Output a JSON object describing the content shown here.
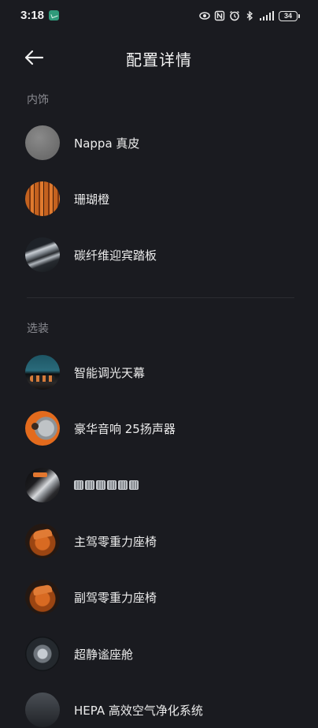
{
  "status_bar": {
    "time": "3:18",
    "battery": "34",
    "icons": [
      "eye-icon",
      "nfc-icon",
      "alarm-icon",
      "bluetooth-icon",
      "signal-icon",
      "battery-icon"
    ]
  },
  "header": {
    "title": "配置详情",
    "back_icon": "arrow-left-icon"
  },
  "sections": {
    "interior": {
      "label": "内饰",
      "items": [
        {
          "label": "Nappa 真皮",
          "thumb": "nappa-leather-swatch"
        },
        {
          "label": "珊瑚橙",
          "thumb": "coral-orange-swatch"
        },
        {
          "label": "碳纤维迎宾踏板",
          "thumb": "carbon-fiber-sill-plate"
        }
      ]
    },
    "options": {
      "label": "选装",
      "items": [
        {
          "label": "智能调光天幕",
          "thumb": "smart-dimming-roof"
        },
        {
          "label": "",
          "thumb": "premium-audio-speaker"
        },
        {
          "label": "",
          "thumb": "obscured-option"
        },
        {
          "label": "主驾零重力座椅",
          "thumb": "driver-zero-gravity-seat"
        },
        {
          "label": "副驾零重力座椅",
          "thumb": "passenger-zero-gravity-seat"
        },
        {
          "label": "超静谧座舱",
          "thumb": "ultra-quiet-cabin"
        },
        {
          "label": "HEPA 高效空气净化系统",
          "thumb": "hepa-air-purifier"
        }
      ]
    }
  },
  "audio_item_label": "豪华音响 25扬声器"
}
